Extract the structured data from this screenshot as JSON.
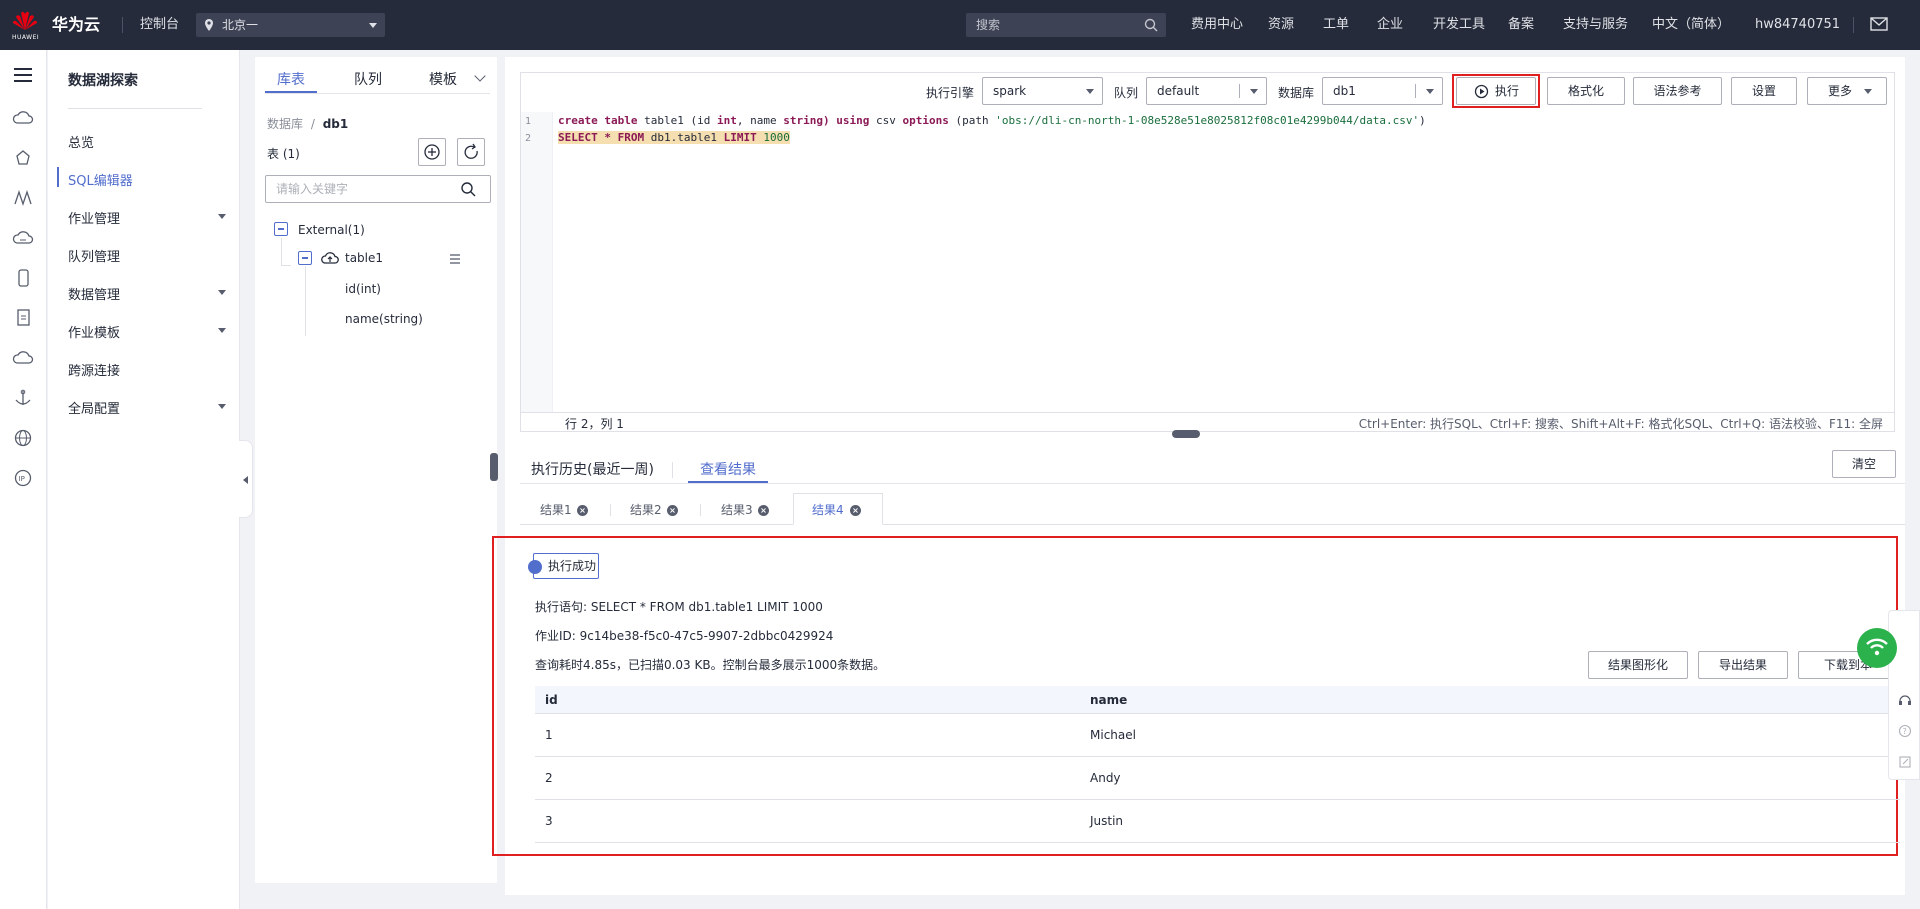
{
  "topbar": {
    "logo_text": "HUAWEI",
    "brand": "华为云",
    "console": "控制台",
    "region": "北京一",
    "search_placeholder": "搜索",
    "links": [
      "费用中心",
      "资源",
      "工单",
      "企业",
      "开发工具",
      "备案",
      "支持与服务",
      "中文（简体）",
      "hw84740751"
    ]
  },
  "nav": {
    "title": "数据湖探索",
    "items": [
      {
        "label": "总览",
        "active": false,
        "expandable": false
      },
      {
        "label": "SQL编辑器",
        "active": true,
        "expandable": false
      },
      {
        "label": "作业管理",
        "active": false,
        "expandable": true
      },
      {
        "label": "队列管理",
        "active": false,
        "expandable": false
      },
      {
        "label": "数据管理",
        "active": false,
        "expandable": true
      },
      {
        "label": "作业模板",
        "active": false,
        "expandable": true
      },
      {
        "label": "跨源连接",
        "active": false,
        "expandable": false
      },
      {
        "label": "全局配置",
        "active": false,
        "expandable": true
      }
    ]
  },
  "catalog": {
    "tabs": [
      "库表",
      "队列",
      "模板"
    ],
    "breadcrumb_root": "数据库",
    "breadcrumb_sep": "/",
    "breadcrumb_current": "db1",
    "table_count": "表 (1)",
    "search_placeholder": "请输入关键字",
    "tree": {
      "group": "External(1)",
      "table": "table1",
      "columns": [
        "id(int)",
        "name(string)"
      ]
    }
  },
  "editor": {
    "engine_label": "执行引擎",
    "engine_value": "spark",
    "queue_label": "队列",
    "queue_value": "default",
    "db_label": "数据库",
    "db_value": "db1",
    "run_label": "执行",
    "format_label": "格式化",
    "syntax_label": "语法参考",
    "settings_label": "设置",
    "more_label": "更多",
    "line_numbers": [
      "1",
      "2"
    ],
    "code": {
      "l1_create": "create",
      "l1_table": "table",
      "l1_name": "table1",
      "l1_cols": "(id",
      "l1_int": "int",
      "l1_comma": ", name",
      "l1_string": "string)",
      "l1_using": "using",
      "l1_csv": "csv",
      "l1_options": "options",
      "l1_path": "(path",
      "l1_str": "'obs://dli-cn-north-1-08e528e51e8025812f08c01e4299b044/data.csv'",
      "l1_close": ")",
      "l2_select": "SELECT",
      "l2_star": "*",
      "l2_from": "FROM",
      "l2_obj": "db1.table1",
      "l2_limit": "LIMIT",
      "l2_num": "1000"
    },
    "cursor_pos": "行 2，列 1",
    "shortcuts": "Ctrl+Enter: 执行SQL、Ctrl+F: 搜索、Shift+Alt+F: 格式化SQL、Ctrl+Q: 语法校验、F11: 全屏"
  },
  "results": {
    "tabs": [
      "执行历史(最近一周)",
      "查看结果"
    ],
    "clear_label": "清空",
    "subtabs": [
      "结果1",
      "结果2",
      "结果3",
      "结果4"
    ],
    "status": "执行成功",
    "statement": "执行语句: SELECT * FROM db1.table1 LIMIT 1000",
    "job_id": "作业ID: 9c14be38-f5c0-47c5-9907-2dbbc0429924",
    "summary": "查询耗时4.85s，已扫描0.03 KB。控制台最多展示1000条数据。",
    "actions": [
      "结果图形化",
      "导出结果",
      "下载到本"
    ],
    "columns": [
      "id",
      "name"
    ],
    "rows": [
      [
        "1",
        "Michael"
      ],
      [
        "2",
        "Andy"
      ],
      [
        "3",
        "Justin"
      ]
    ]
  },
  "colors": {
    "topbar": "#252b3a",
    "accent": "#526ecc",
    "highlight_outline": "#e02020",
    "selection": "#f5deb0"
  }
}
